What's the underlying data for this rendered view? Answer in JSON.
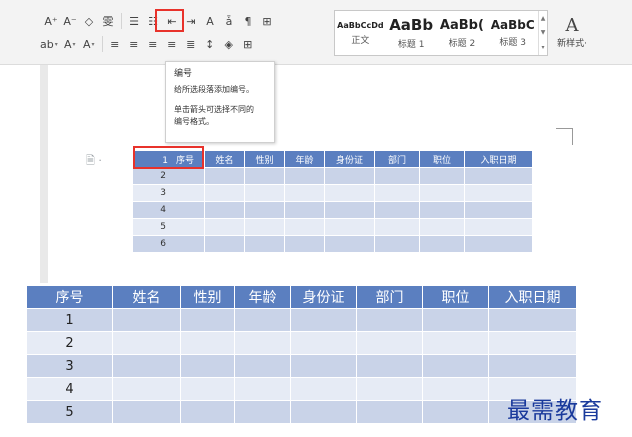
{
  "ribbon": {
    "row1_buttons": [
      {
        "label": "A⁺",
        "name": "grow-font-button"
      },
      {
        "label": "A⁻",
        "name": "shrink-font-button"
      },
      {
        "label": "◇",
        "name": "clear-format-icon"
      },
      {
        "label": "雯",
        "name": "phonetic-guide-button"
      }
    ],
    "row1_para": [
      {
        "label": "☰",
        "name": "bullets-button"
      },
      {
        "label": "☷",
        "name": "numbering-button"
      },
      {
        "label": "⇤",
        "name": "decrease-indent-button"
      },
      {
        "label": "⇥",
        "name": "increase-indent-button"
      },
      {
        "label": "A",
        "name": "change-case-button"
      },
      {
        "label": "ǡ",
        "name": "sort-button"
      },
      {
        "label": "¶",
        "name": "show-marks-button"
      },
      {
        "label": "⊞",
        "name": "table-borders-button"
      }
    ],
    "row2_buttons": [
      {
        "label": "ab",
        "name": "highlight-button"
      },
      {
        "label": "A",
        "name": "font-color-button"
      },
      {
        "label": "A",
        "name": "char-shading-button"
      }
    ],
    "row2_para": [
      {
        "label": "≡",
        "name": "align-left-button"
      },
      {
        "label": "≡",
        "name": "align-center-button"
      },
      {
        "label": "≡",
        "name": "align-right-button"
      },
      {
        "label": "≡",
        "name": "justify-button"
      },
      {
        "label": "≣",
        "name": "distributed-button"
      },
      {
        "label": "↕",
        "name": "line-spacing-button"
      },
      {
        "label": "◈",
        "name": "shading-button"
      },
      {
        "label": "⊞",
        "name": "borders-button"
      }
    ],
    "styles": [
      {
        "preview": "AaBbCcDd",
        "name": "正文",
        "size": "8px"
      },
      {
        "preview": "AaBb",
        "name": "标题 1",
        "size": "15px"
      },
      {
        "preview": "AaBb(",
        "name": "标题 2",
        "size": "13px"
      },
      {
        "preview": "AaBbC",
        "name": "标题 3",
        "size": "12px"
      }
    ],
    "new_style_icon": "A",
    "new_style_label": "新样式·"
  },
  "tooltip": {
    "title": "编号",
    "line1": "给所选段落添加编号。",
    "line2": "单击箭头可选择不同的",
    "line3": "编号格式。"
  },
  "table_small": {
    "headers": [
      "序号",
      "姓名",
      "性别",
      "年龄",
      "身份证",
      "部门",
      "职位",
      "入职日期"
    ],
    "header_num": "1",
    "rows": [
      "2",
      "3",
      "4",
      "5",
      "6"
    ]
  },
  "table_large": {
    "headers": [
      "序号",
      "姓名",
      "性别",
      "年龄",
      "身份证",
      "部门",
      "职位",
      "入职日期"
    ],
    "rows": [
      "1",
      "2",
      "3",
      "4",
      "5"
    ]
  },
  "watermark": "最需教育",
  "colors": {
    "header_blue": "#5b7fc0",
    "row_dark": "#c9d3e8",
    "row_light": "#e6ebf5",
    "highlight_red": "#e8322b",
    "watermark_blue": "#1a3a9c"
  }
}
